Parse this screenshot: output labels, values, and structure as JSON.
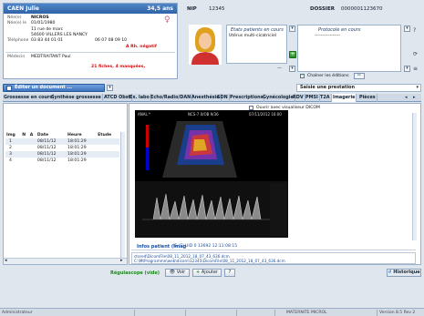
{
  "patient": {
    "name": "CAEN Julie",
    "age": "34,5 ans",
    "labels": {
      "nee": "Née(e)",
      "nee_le": "Née(e) le",
      "telephone": "Téléphone",
      "medecin": "Médecin"
    },
    "birth_name": "NICROS",
    "birth_date": "01/01/1980",
    "address1": "11 rue de marc",
    "address2": "54600 VILLERS LES NANCY",
    "phone1": "03 83 44 01 01",
    "phone2": "06 07 08 09 10",
    "rh": "A Rh. négatif",
    "doctor": "MEDTRAITANT Paul",
    "alert": "21 fiches, 4 masquées,"
  },
  "header": {
    "nip_label": "NIP",
    "nip": "12345",
    "dossier_label": "DOSSIER",
    "dossier": "0000001123670"
  },
  "etats": {
    "title": "Etats patients en cours",
    "item": "Utérus multi-cicatriciel"
  },
  "protocoles": {
    "title": "Protocole en cours",
    "item": "-----------------"
  },
  "chainer": "Chaîner les éditions",
  "actions": {
    "editer": "Éditer un document ...",
    "saisie": "Saisie une prestation"
  },
  "tabs": [
    "Grossesse en cours",
    "Synthèse grossesse",
    "ATCD Obst",
    "Ex. labo",
    "Echo/Radio/DAN",
    "Anesthésie",
    "SDN",
    "Prescriptions",
    "Gynécologie",
    "RDV",
    "PMSI",
    "T2A",
    "Imagerie",
    "Pièces"
  ],
  "active_tab": "Imagerie",
  "images": {
    "headers": [
      "Img",
      "N",
      "A",
      "Date",
      "Heure",
      "Etude"
    ],
    "rows": [
      [
        "1",
        "",
        "",
        "08/11/12",
        "18:01:29",
        ""
      ],
      [
        "2",
        "",
        "",
        "08/11/12",
        "18:01:29",
        ""
      ],
      [
        "3",
        "",
        "",
        "08/11/12",
        "18:01:29",
        ""
      ],
      [
        "4",
        "",
        "",
        "08/11/12",
        "18:01:29",
        ""
      ]
    ]
  },
  "viewer": {
    "dicom_option": "Ouvrir avec visualiseur DICOM",
    "info_label": "Infos patient (Imag",
    "info_value": "IE (F)  UID 0 13692 12:11:08:15",
    "path1": "ctored\\DicomFile\\08_11_2012_18_07_43_636.dcm",
    "path2": "C:\\MtProgramme\\web\\dicom\\12345\\DicomFile\\08_11_2012_18_07_43_636.dcm",
    "overlay_tl": "ANAL *",
    "overlay_tr": "07/11/2012 16:00",
    "overlay_tc": "NCS-7 0/OB  9/36"
  },
  "bottom": {
    "regulascope": "Régulascope (vide)",
    "voir": "Voir",
    "ajouter": "Ajouter",
    "historique": "Historique"
  },
  "status": {
    "user": "Administrateur",
    "site": "MATERNITE MICROL",
    "version": "Version 8.5 Rev 2"
  },
  "colors": {
    "header_blue": "#2e63a8",
    "alert_red": "#d01010",
    "accent_green": "#2a8c2a"
  }
}
